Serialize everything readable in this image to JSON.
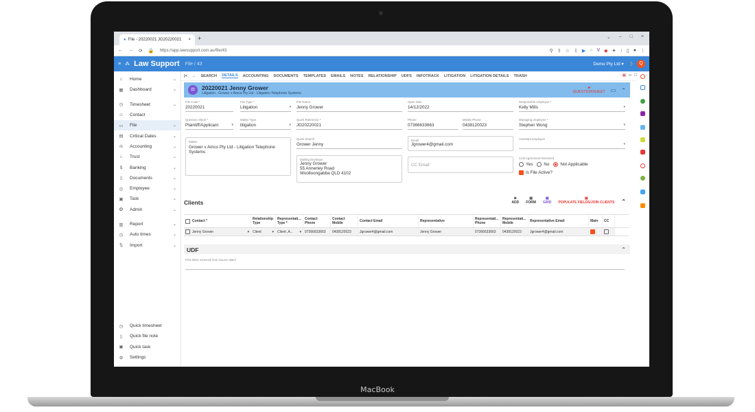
{
  "device": {
    "brand": "MacBook"
  },
  "browser": {
    "tab_title": "File - 20220021 JG20220021",
    "url": "https://app.lawsupport.com.au/file/43"
  },
  "app": {
    "name": "Law Support",
    "breadcrumb": "File / 43",
    "company": "Demo Pty Ltd ▾",
    "avatar": "Q"
  },
  "sidebar": {
    "items": [
      {
        "label": "Home",
        "icon": "home-icon"
      },
      {
        "label": "Dashboard",
        "icon": "dashboard-icon"
      },
      {
        "label": "Timesheet",
        "icon": "clock-icon"
      },
      {
        "label": "Contact",
        "icon": "people-icon"
      },
      {
        "label": "File",
        "icon": "folder-icon"
      },
      {
        "label": "Critical Dates",
        "icon": "calendar-icon"
      },
      {
        "label": "Accounting",
        "icon": "chart-icon"
      },
      {
        "label": "Trust",
        "icon": "bank-icon"
      },
      {
        "label": "Banking",
        "icon": "money-icon"
      },
      {
        "label": "Documents",
        "icon": "document-icon"
      },
      {
        "label": "Employee",
        "icon": "person-icon"
      },
      {
        "label": "Task",
        "icon": "task-icon"
      },
      {
        "label": "Admin",
        "icon": "admin-icon"
      },
      {
        "label": "Report",
        "icon": "report-icon"
      },
      {
        "label": "Auto times",
        "icon": "timer-icon"
      },
      {
        "label": "Import",
        "icon": "import-icon"
      }
    ],
    "quick": [
      {
        "label": "Quick timesheet"
      },
      {
        "label": "Quick file note"
      },
      {
        "label": "Quick task"
      },
      {
        "label": "Settings"
      }
    ]
  },
  "tabs": [
    "SEARCH",
    "DETAILS",
    "ACCOUNTING",
    "DOCUMENTS",
    "TEMPLATES",
    "EMAILS",
    "NOTES",
    "RELATIONSHIP",
    "UDFS",
    "INFOTRACK",
    "LITIGATION",
    "LITIGATION DETAILS",
    "TRASH"
  ],
  "file_header": {
    "title": "20220021 Jenny Grower",
    "subtitle": "Litigation , Grower v Amco Pty Ltd - Litigation Telephone Systems",
    "quick_link": "QUESTIONSHEET"
  },
  "form": {
    "file_code": {
      "label": "File Code *",
      "value": "20220021"
    },
    "file_type": {
      "label": "File Type *",
      "value": "Litigation"
    },
    "file_name": {
      "label": "File Name",
      "value": "Jenny Grower"
    },
    "open_date": {
      "label": "Open date",
      "value": "14/12/2022"
    },
    "responsible": {
      "label": "Responsible employee *",
      "value": "Kelly Mills"
    },
    "question_sheet": {
      "label": "Question Sheet *",
      "value": "Plaintiff/Applicant"
    },
    "matter_type": {
      "label": "Matter Type",
      "value": "litigation"
    },
    "quick_ref": {
      "label": "Quick Reference *",
      "value": "JG20220021"
    },
    "phone": {
      "label": "Phone",
      "value": "07366633663"
    },
    "mobile": {
      "label": "Mobile Phone",
      "value": "0438120023"
    },
    "managing": {
      "label": "Managing employee *",
      "value": "Stephen Wong"
    },
    "matter": {
      "label": "Matter",
      "value": "Grower v Amco Pty Ltd - Litigation Telephone Systems"
    },
    "quick_search": {
      "label": "Quick Search",
      "value": "Grower Jenny"
    },
    "email": {
      "label": "Email",
      "value": "Jgrower4@gmail.com"
    },
    "assistant": {
      "label": "Assistant employee",
      "value": ""
    },
    "mailing": {
      "label": "Mailing Envelope",
      "line1": "Jenny Grower",
      "line2": "55 Annerley Road",
      "line3": "Woolloongabba QLD 4102"
    },
    "cc_email": {
      "placeholder": "CC Email"
    },
    "cost_agreement": {
      "label": "Cost Agreement Received",
      "yes": "Yes",
      "no": "No",
      "na": "Not Applicable"
    },
    "is_active": {
      "label": "Is File Active?"
    }
  },
  "clients": {
    "title": "Clients",
    "actions": {
      "add": "ADD",
      "form": "FORM",
      "grid": "GRID",
      "populate": "POPULATE FIELDS/JOIN CLIENTS"
    },
    "columns": [
      "Contact *",
      "Relationship Type",
      "Representati... Type *",
      "Contact Phone",
      "Contact Mobile",
      "Contact Email",
      "Representative",
      "Representati... Phone",
      "Representati... Mobile",
      "Representative Email",
      "Main",
      "CC"
    ],
    "rows": [
      [
        "Jenny Grower",
        "Client",
        "Client ,A...",
        "07366633663",
        "0438120023",
        "Jgrower4@gmail.com",
        "Jenny Grower",
        "07366633663",
        "0438120023",
        "Jgrower4@gmail.com"
      ]
    ]
  },
  "udf": {
    "title": "UDF",
    "field_label": "First letter recieved from insurer date?"
  },
  "colors": {
    "appbar": "#3a86d8",
    "header_band": "#82bbec",
    "accent_red": "#e53935"
  }
}
